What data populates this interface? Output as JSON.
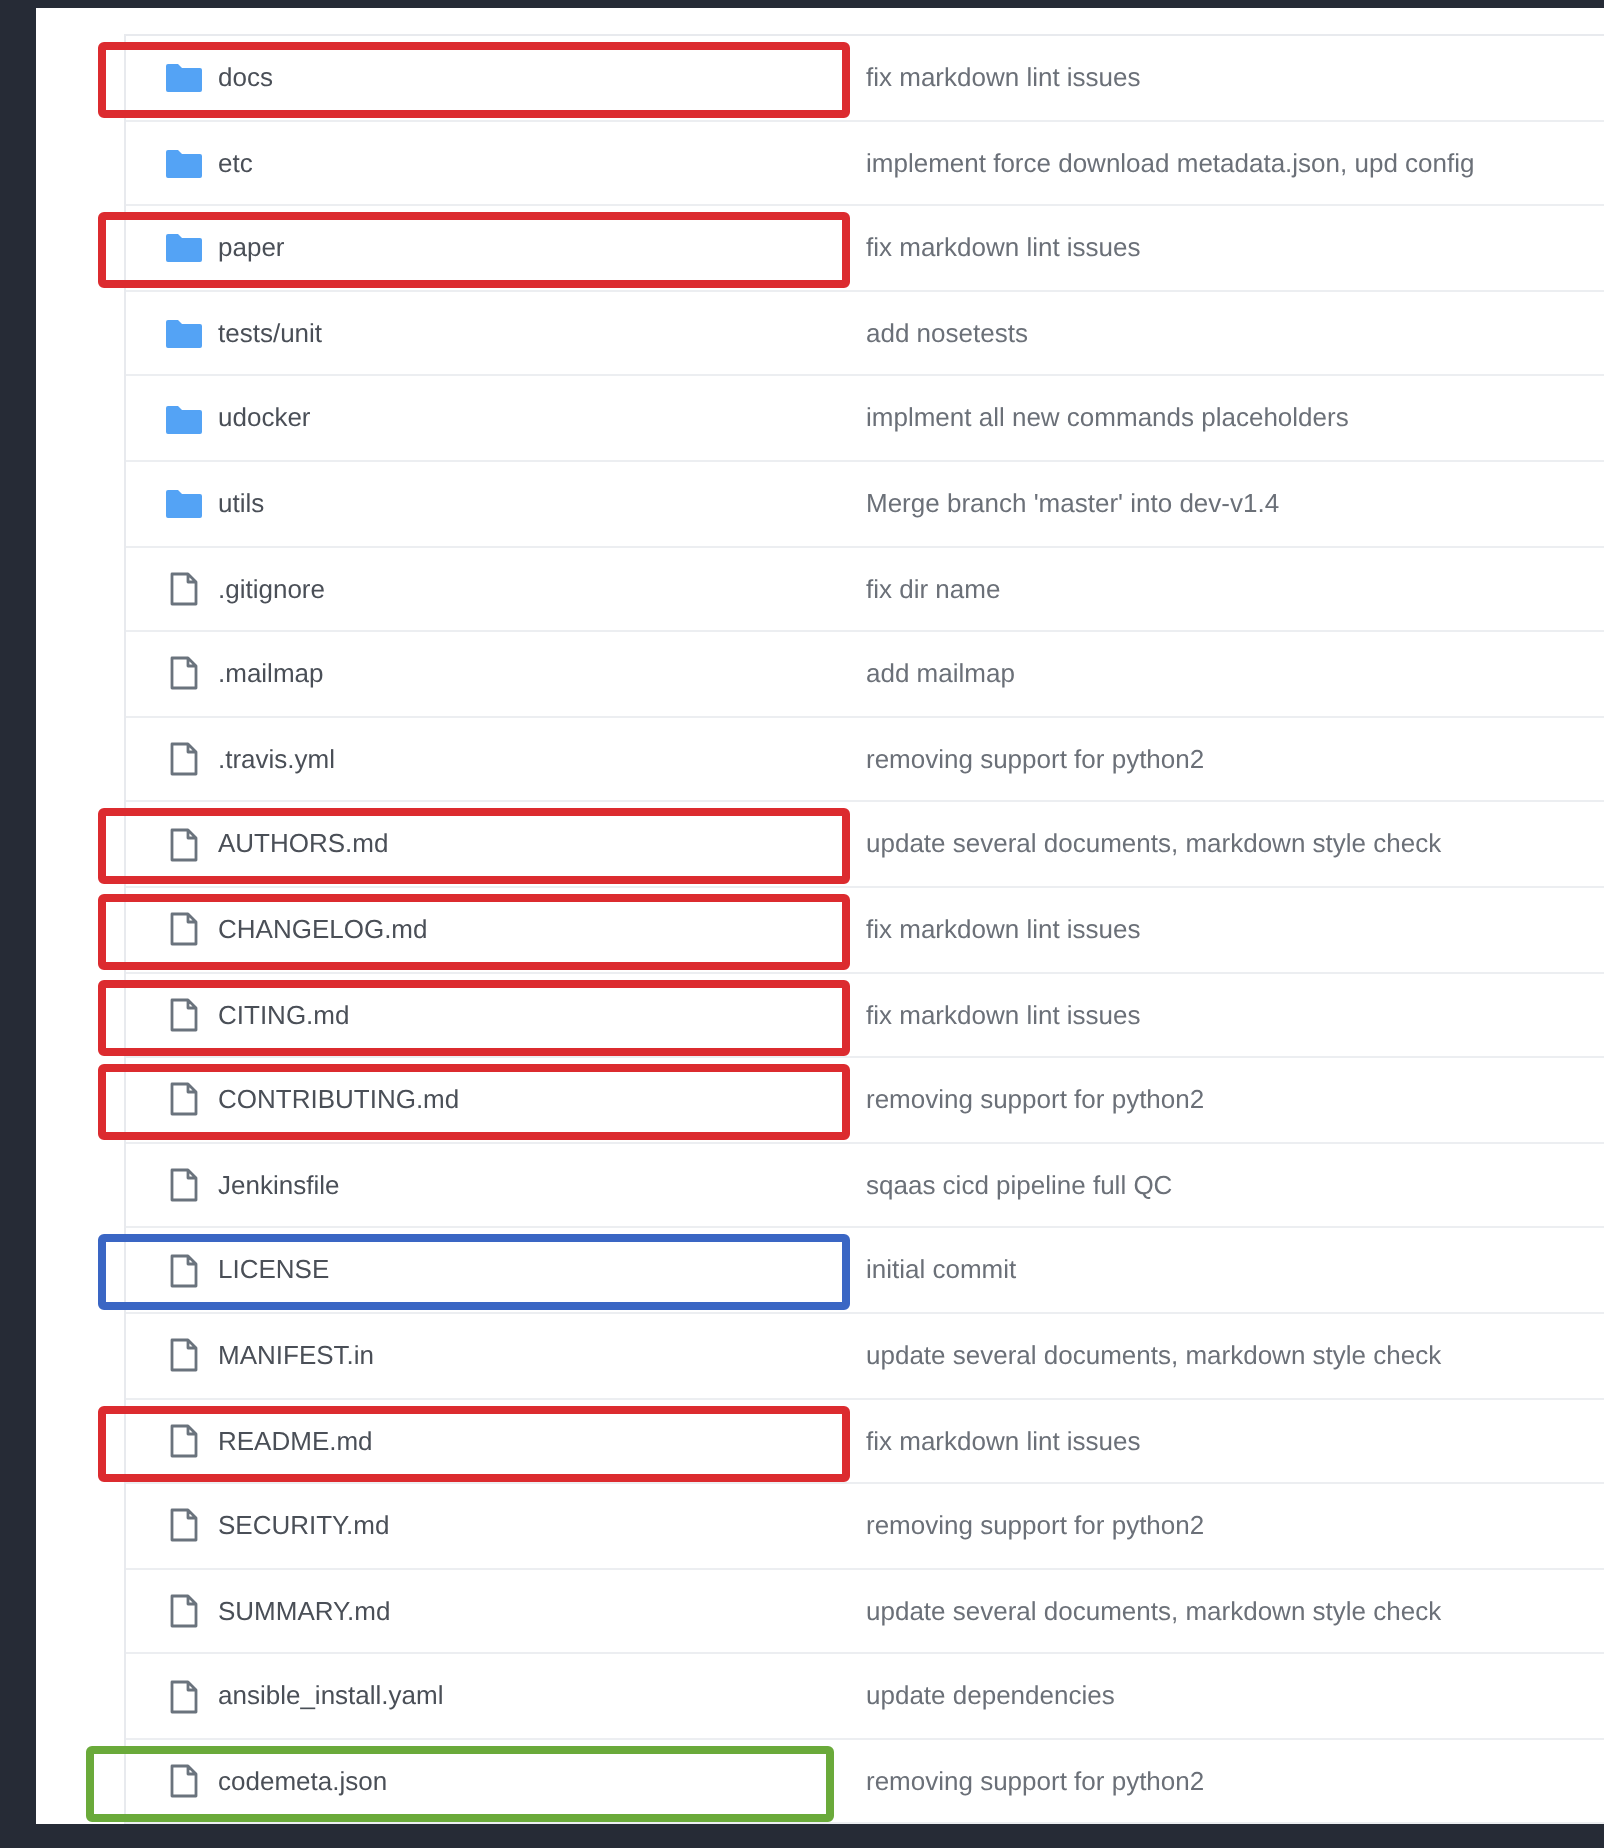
{
  "files": [
    {
      "kind": "folder",
      "name": "docs",
      "message": "fix markdown lint issues",
      "color": "#dc2b2f"
    },
    {
      "kind": "folder",
      "name": "etc",
      "message": "implement force download metadata.json, upd config"
    },
    {
      "kind": "folder",
      "name": "paper",
      "message": "fix markdown lint issues",
      "color": "#dc2b2f"
    },
    {
      "kind": "folder",
      "name": "tests/unit",
      "message": "add nosetests"
    },
    {
      "kind": "folder",
      "name": "udocker",
      "message": "implment all new commands placeholders"
    },
    {
      "kind": "folder",
      "name": "utils",
      "message": "Merge branch 'master' into dev-v1.4"
    },
    {
      "kind": "file",
      "name": ".gitignore",
      "message": "fix dir name"
    },
    {
      "kind": "file",
      "name": ".mailmap",
      "message": "add mailmap"
    },
    {
      "kind": "file",
      "name": ".travis.yml",
      "message": "removing support for python2"
    },
    {
      "kind": "file",
      "name": "AUTHORS.md",
      "message": "update several documents, markdown style check",
      "color": "#dc2b2f"
    },
    {
      "kind": "file",
      "name": "CHANGELOG.md",
      "message": "fix markdown lint issues",
      "color": "#dc2b2f"
    },
    {
      "kind": "file",
      "name": "CITING.md",
      "message": "fix markdown lint issues",
      "color": "#dc2b2f"
    },
    {
      "kind": "file",
      "name": "CONTRIBUTING.md",
      "message": "removing support for python2",
      "color": "#dc2b2f"
    },
    {
      "kind": "file",
      "name": "Jenkinsfile",
      "message": "sqaas cicd pipeline full QC"
    },
    {
      "kind": "file",
      "name": "LICENSE",
      "message": "initial commit",
      "color": "#3a66c4"
    },
    {
      "kind": "file",
      "name": "MANIFEST.in",
      "message": "update several documents, markdown style check"
    },
    {
      "kind": "file",
      "name": "README.md",
      "message": "fix markdown lint issues",
      "color": "#dc2b2f"
    },
    {
      "kind": "file",
      "name": "SECURITY.md",
      "message": "removing support for python2"
    },
    {
      "kind": "file",
      "name": "SUMMARY.md",
      "message": "update several documents, markdown style check"
    },
    {
      "kind": "file",
      "name": "ansible_install.yaml",
      "message": "update dependencies"
    },
    {
      "kind": "file",
      "name": "codemeta.json",
      "message": "removing support for python2",
      "color": "#6aaa3a"
    }
  ]
}
